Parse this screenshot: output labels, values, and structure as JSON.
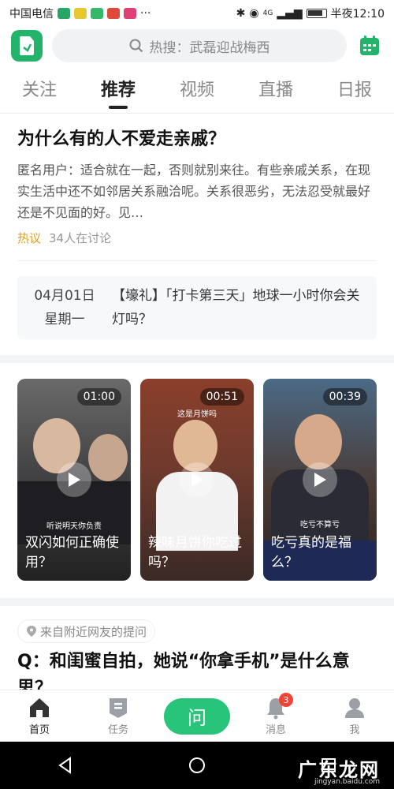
{
  "status_bar": {
    "carrier": "中国电信",
    "signal_label": "4G",
    "time": "半夜12:10"
  },
  "header": {
    "search_placeholder": "热搜：武磊迎战梅西"
  },
  "tabs": [
    {
      "label": "关注"
    },
    {
      "label": "推荐"
    },
    {
      "label": "视频"
    },
    {
      "label": "直播"
    },
    {
      "label": "日报"
    }
  ],
  "article": {
    "title": "为什么有的人不爱走亲戚？",
    "body": "匿名用户：适合就在一起，否则就别来往。有些亲戚关系，在现实生活中还不如邻居关系融洽呢。关系很恶劣，无法忍受就最好还是不见面的好。见…",
    "tag": "热议",
    "discussion": "34人在讨论"
  },
  "daily": {
    "date": "04月01日",
    "weekday": "星期一",
    "text": "【壕礼】「打卡第三天」地球一小时你会关灯吗？"
  },
  "videos": [
    {
      "duration": "01:00",
      "caption": "双闪如何正确使用？",
      "subtitle": "听说明天你负责"
    },
    {
      "duration": "00:51",
      "caption": "辣味月饼你吃过吗？",
      "subtitle": "这是月饼吗"
    },
    {
      "duration": "00:39",
      "caption": "吃亏真的是福么？",
      "subtitle": "吃亏不算亏"
    }
  ],
  "question": {
    "source": "来自附近网友的提问",
    "title": "Q：和闺蜜自拍，她说“你拿手机”是什么意思？"
  },
  "bottom_nav": {
    "home": "首页",
    "tasks": "任务",
    "ask": "问",
    "messages": "消息",
    "messages_badge": "3",
    "me": "我"
  },
  "watermark": {
    "text": "广东龙网",
    "sub": "jingyan.baidu.com"
  },
  "colors": {
    "brand_green": "#28c47a",
    "hot_tag": "#e0a020",
    "badge_red": "#f44336"
  }
}
